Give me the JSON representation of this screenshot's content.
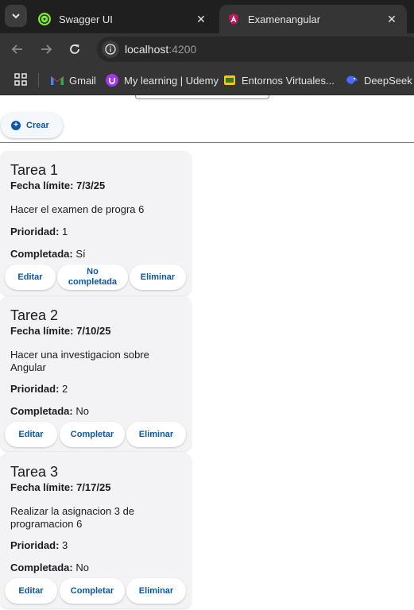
{
  "browser": {
    "tabs": [
      {
        "title": "Swagger UI",
        "favicon": "swagger-favicon-icon",
        "active": false
      },
      {
        "title": "Examenangular",
        "favicon": "angular-favicon-icon",
        "active": true
      }
    ],
    "url_host": "localhost",
    "url_port": ":4200",
    "bookmarks": [
      {
        "label": "Gmail",
        "icon": "gmail-icon"
      },
      {
        "label": "My learning | Udemy",
        "icon": "udemy-icon"
      },
      {
        "label": "Entornos Virtuales...",
        "icon": "entornos-icon"
      },
      {
        "label": "DeepSeek -",
        "icon": "deepseek-icon"
      }
    ]
  },
  "page": {
    "create_label": "Crear",
    "labels": {
      "deadline": "Fecha límite:",
      "priority": "Prioridad:",
      "completed": "Completada:"
    },
    "tasks": [
      {
        "title": "Tarea 1",
        "deadline": "7/3/25",
        "description": "Hacer el examen de progra 6",
        "priority": "1",
        "completed": "Sí",
        "actions": {
          "edit": "Editar",
          "toggle": "No completada",
          "delete": "Eliminar"
        }
      },
      {
        "title": "Tarea 2",
        "deadline": "7/10/25",
        "description": "Hacer una investigacion sobre Angular",
        "priority": "2",
        "completed": "No",
        "actions": {
          "edit": "Editar",
          "toggle": "Completar",
          "delete": "Eliminar"
        }
      },
      {
        "title": "Tarea 3",
        "deadline": "7/17/25",
        "description": "Realizar la asignacion 3 de programacion 6",
        "priority": "3",
        "completed": "No",
        "actions": {
          "edit": "Editar",
          "toggle": "Completar",
          "delete": "Eliminar"
        }
      }
    ]
  },
  "colors": {
    "accent": "#0b57a8",
    "card_bg": "#f3f3f6",
    "chrome_dark": "#1f1f1f",
    "chrome_toolbar": "#353535"
  }
}
